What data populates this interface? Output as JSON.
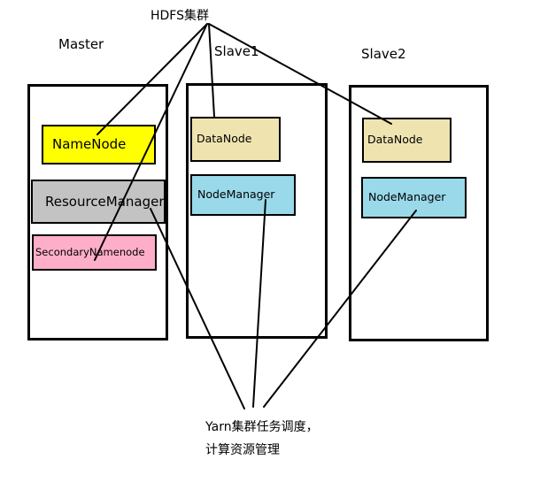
{
  "diagram": {
    "hdfs_label": "HDFS集群",
    "yarn_label_line1": "Yarn集群任务调度，",
    "yarn_label_line2": "计算资源管理",
    "hosts": {
      "master": {
        "title": "Master",
        "namenode": "NameNode",
        "resourcemanager": "ResourceManager",
        "secondarynamenode": "SecondaryNamenode"
      },
      "slave1": {
        "title": "Slave1",
        "datanode": "DataNode",
        "nodemanager": "NodeManager"
      },
      "slave2": {
        "title": "Slave2",
        "datanode": "DataNode",
        "nodemanager": "NodeManager"
      }
    },
    "colors": {
      "namenode": "#ffff00",
      "resourcemanager": "#c3c3c3",
      "secondarynamenode": "#ffaec9",
      "datanode": "#efe4b0",
      "nodemanager": "#99d9ea",
      "line": "#000000"
    }
  }
}
